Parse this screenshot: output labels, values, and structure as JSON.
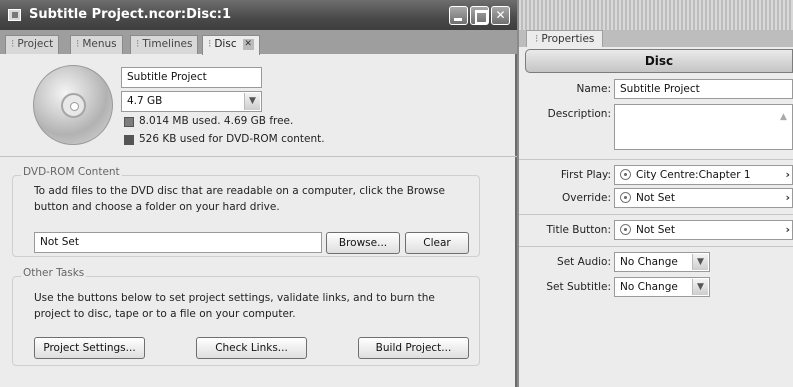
{
  "left_window": {
    "title": "Subtitle Project.ncor:Disc:1",
    "tabs": [
      {
        "label": "Project"
      },
      {
        "label": "Menus"
      },
      {
        "label": "Timelines"
      },
      {
        "label": "Disc"
      }
    ],
    "disc": {
      "name_value": "Subtitle Project",
      "size_value": "4.7 GB",
      "used_text": "8.014 MB used.  4.69 GB free.",
      "dvdrom_text": "526 KB used for DVD-ROM content.",
      "used_color": "#7d7d7d",
      "dvdrom_color": "#555555"
    },
    "dvd_rom": {
      "title": "DVD-ROM Content",
      "description": "To add files to the DVD disc that are readable on a computer, click the Browse button and choose a folder on your hard drive.",
      "path_value": "Not Set",
      "browse_label": "Browse...",
      "clear_label": "Clear"
    },
    "other_tasks": {
      "title": "Other Tasks",
      "description": "Use the buttons below to set project settings, validate links, and to burn the project to disc, tape or to a file on your computer.",
      "project_settings_label": "Project Settings...",
      "check_links_label": "Check Links...",
      "build_project_label": "Build Project..."
    }
  },
  "properties_panel": {
    "tab_label": "Properties",
    "header": "Disc",
    "name_label": "Name:",
    "name_value": "Subtitle Project",
    "description_label": "Description:",
    "first_play_label": "First Play:",
    "first_play_value": "City Centre:Chapter 1",
    "override_label": "Override:",
    "override_value": "Not Set",
    "title_button_label": "Title Button:",
    "title_button_value": "Not Set",
    "set_audio_label": "Set Audio:",
    "set_audio_value": "No Change",
    "set_subtitle_label": "Set Subtitle:",
    "set_subtitle_value": "No Change"
  }
}
